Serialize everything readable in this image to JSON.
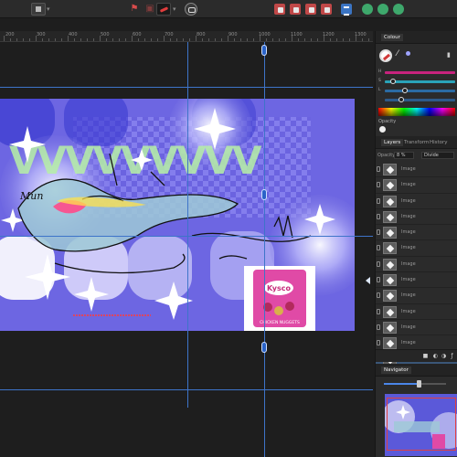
{
  "ruler": {
    "ticks": [
      "200",
      "300",
      "400",
      "500",
      "600",
      "700",
      "800",
      "900",
      "1000",
      "1100",
      "1200",
      "1300"
    ]
  },
  "panel": {
    "color_tab": "Colour",
    "slider_labels": [
      "H",
      "S",
      "L"
    ],
    "opacity_label": "Opacity",
    "layers_tabs": [
      "Layers",
      "Transform",
      "History"
    ],
    "layer_opacity_label": "Opacity",
    "layer_opacity_value": "8 %",
    "blend_mode": "Divide",
    "layers": [
      {
        "name": "Image",
        "selected": false
      },
      {
        "name": "Image",
        "selected": false
      },
      {
        "name": "Image",
        "selected": false
      },
      {
        "name": "Image",
        "selected": false
      },
      {
        "name": "Image",
        "selected": false
      },
      {
        "name": "Image",
        "selected": false
      },
      {
        "name": "Image",
        "selected": false
      },
      {
        "name": "Image",
        "selected": false
      },
      {
        "name": "Image",
        "selected": false
      },
      {
        "name": "Image",
        "selected": false
      },
      {
        "name": "Image",
        "selected": false
      },
      {
        "name": "Image",
        "selected": false
      },
      {
        "name": "Image",
        "selected": true
      }
    ],
    "navigator_tab": "Navigator"
  },
  "artwork": {
    "product_label": "Kysco",
    "product_caption": "CHICKEN NUGGETS",
    "signature": "Mun"
  },
  "colors": {
    "accent": "#3e74c9",
    "selected_layer": "#3a5677",
    "hue_slider": "#c8237d",
    "sat_slider": "#2aa3b8",
    "light_slider": "#2b6ba3"
  },
  "icons": {
    "toolbar": [
      "document-icon",
      "persona-pixel-icon",
      "persona-export-icon",
      "persona-draw-icon",
      "assistant-icon",
      "boolean-add-icon",
      "boolean-subtract-icon",
      "boolean-intersect-icon",
      "boolean-xor-icon",
      "align-icon",
      "insert-behind-icon",
      "insert-top-icon",
      "insert-inside-icon"
    ]
  }
}
